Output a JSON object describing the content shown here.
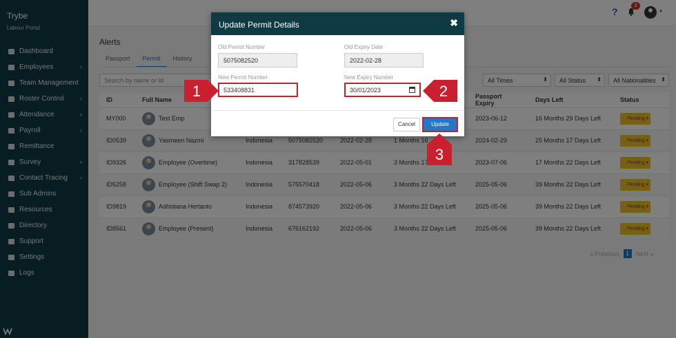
{
  "app": {
    "name": "Trybe",
    "subtitle": "Labour Portal"
  },
  "sidebar": {
    "items": [
      {
        "label": "Dashboard",
        "icon": "dashboard-icon",
        "has_submenu": false
      },
      {
        "label": "Employees",
        "icon": "employees-icon",
        "has_submenu": true
      },
      {
        "label": "Team Management",
        "icon": "team-icon",
        "has_submenu": false
      },
      {
        "label": "Roster Control",
        "icon": "roster-icon",
        "has_submenu": true
      },
      {
        "label": "Attendance",
        "icon": "attendance-icon",
        "has_submenu": true
      },
      {
        "label": "Payroll",
        "icon": "payroll-icon",
        "has_submenu": true
      },
      {
        "label": "Remittance",
        "icon": "remittance-icon",
        "has_submenu": false
      },
      {
        "label": "Survey",
        "icon": "survey-icon",
        "has_submenu": true
      },
      {
        "label": "Contact Tracing",
        "icon": "contact-tracing-icon",
        "has_submenu": true
      },
      {
        "label": "Sub Admins",
        "icon": "sub-admins-icon",
        "has_submenu": false
      },
      {
        "label": "Resources",
        "icon": "resources-icon",
        "has_submenu": false
      },
      {
        "label": "Directory",
        "icon": "directory-icon",
        "has_submenu": false
      },
      {
        "label": "Support",
        "icon": "support-icon",
        "has_submenu": false
      },
      {
        "label": "Settings",
        "icon": "settings-icon",
        "has_submenu": false
      },
      {
        "label": "Logs",
        "icon": "logs-icon",
        "has_submenu": false
      }
    ]
  },
  "topbar": {
    "help": "?",
    "notification_count": "3"
  },
  "alerts": {
    "title": "Alerts",
    "tabs": [
      {
        "label": "Passport"
      },
      {
        "label": "Permit"
      },
      {
        "label": "History"
      }
    ],
    "active_tab": "Permit",
    "search_placeholder": "Search by name or Id",
    "filters": {
      "times": "All Times",
      "status": "All Status",
      "nationalities": "All Nationalities"
    }
  },
  "table": {
    "headers": [
      "ID",
      "Full Name",
      "",
      "",
      "",
      "",
      "Passport Expiry",
      "Days Left",
      "Status"
    ],
    "rows": [
      {
        "id": "MY000",
        "name": "Test Emp",
        "nationality": "",
        "permit": "",
        "permit_expiry": "",
        "permit_days": "",
        "passport_expiry": "2023-06-12",
        "days_left": "16 Months 29 Days Left",
        "status": "Pending"
      },
      {
        "id": "ID0539",
        "name": "Yasmeen Nazmi",
        "nationality": "Indonesia",
        "permit": "5075082520",
        "permit_expiry": "2022-02-28",
        "permit_days": "1 Months 16",
        "passport_expiry": "2024-02-29",
        "days_left": "25 Months 17 Days Left",
        "status": "Pending"
      },
      {
        "id": "ID9326",
        "name": "Employee (Overtime)",
        "nationality": "Indonesia",
        "permit": "317828539",
        "permit_expiry": "2022-05-01",
        "permit_days": "3 Months 17",
        "passport_expiry": "2023-07-06",
        "days_left": "17 Months 22 Days Left",
        "status": "Pending"
      },
      {
        "id": "ID5258",
        "name": "Employee (Shift Swap 2)",
        "nationality": "Indonesia",
        "permit": "575570418",
        "permit_expiry": "2022-05-06",
        "permit_days": "3 Months 22 Days Left",
        "passport_expiry": "2025-05-06",
        "days_left": "39 Months 22 Days Left",
        "status": "Pending"
      },
      {
        "id": "ID9819",
        "name": "Adhistana Hertanto",
        "nationality": "Indonesia",
        "permit": "874573920",
        "permit_expiry": "2022-05-06",
        "permit_days": "3 Months 22 Days Left",
        "passport_expiry": "2025-05-06",
        "days_left": "39 Months 22 Days Left",
        "status": "Pending"
      },
      {
        "id": "ID8561",
        "name": "Employee (Present)",
        "nationality": "Indonesia",
        "permit": "676162192",
        "permit_expiry": "2022-05-06",
        "permit_days": "3 Months 22 Days Left",
        "passport_expiry": "2025-05-06",
        "days_left": "39 Months 22 Days Left",
        "status": "Pending"
      }
    ]
  },
  "pagination": {
    "previous": "« Previous",
    "page": "1",
    "next": "Next »"
  },
  "modal": {
    "title": "Update Permit Details",
    "old_permit_label": "Old Permit Number",
    "old_permit_value": "5075082520",
    "old_expiry_label": "Old Expiry Date",
    "old_expiry_value": "2022-02-28",
    "new_permit_label": "New Permit Number",
    "new_permit_value": "533408831",
    "new_expiry_label": "New Expiry Number",
    "new_expiry_value": "30/01/2023",
    "cancel_label": "Cancel",
    "update_label": "Update"
  },
  "callouts": [
    "1",
    "2",
    "3"
  ],
  "colors": {
    "sidebar": "#0e3a44",
    "accent": "#1f78c8",
    "callout": "#c8202f",
    "pending": "#f0bd2e"
  }
}
